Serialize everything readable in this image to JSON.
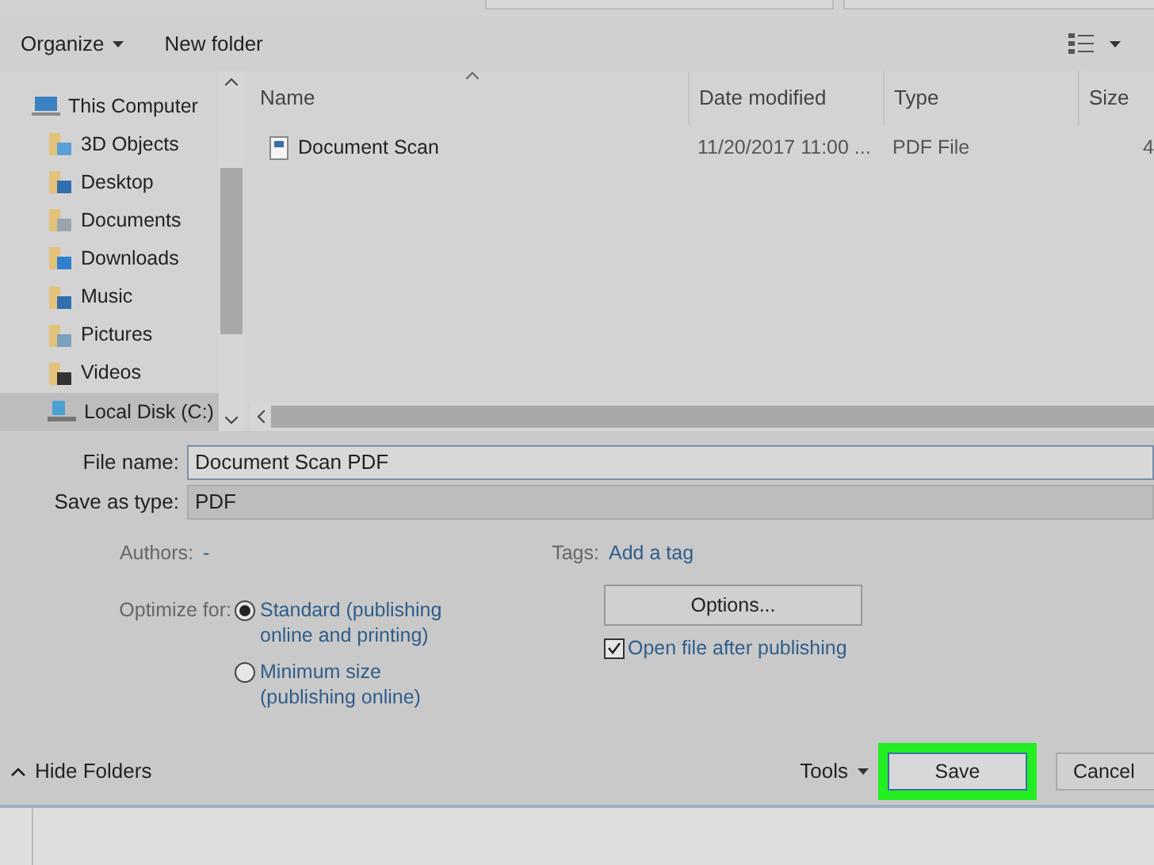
{
  "toolbar": {
    "organize": "Organize",
    "new_folder": "New folder"
  },
  "sidebar": {
    "items": [
      {
        "label": "This Computer",
        "kind": "computer",
        "selected": false,
        "children": [
          {
            "label": "3D Objects",
            "kind": "objects",
            "selected": false
          },
          {
            "label": "Desktop",
            "kind": "desktop",
            "selected": false
          },
          {
            "label": "Documents",
            "kind": "documents",
            "selected": false
          },
          {
            "label": "Downloads",
            "kind": "downloads",
            "selected": false
          },
          {
            "label": "Music",
            "kind": "music",
            "selected": false
          },
          {
            "label": "Pictures",
            "kind": "pictures",
            "selected": false
          },
          {
            "label": "Videos",
            "kind": "videos",
            "selected": false
          },
          {
            "label": "Local Disk (C:)",
            "kind": "disk",
            "selected": true
          }
        ]
      }
    ]
  },
  "table": {
    "columns": [
      "Name",
      "Date modified",
      "Type",
      "Size"
    ],
    "rows": [
      {
        "name": "Document Scan",
        "date": "11/20/2017 11:00 ...",
        "type": "PDF File",
        "size": "4"
      }
    ]
  },
  "form": {
    "file_name_label": "File name:",
    "file_name": "Document Scan PDF",
    "type_label": "Save as type:",
    "type": "PDF",
    "authors_label": "Authors:",
    "authors": "-",
    "tags_label": "Tags:",
    "tags": "Add a tag",
    "optimize_label": "Optimize for:",
    "options": [
      {
        "label": "Standard (publishing online and printing)",
        "selected": true
      },
      {
        "label": "Minimum size (publishing online)",
        "selected": false
      }
    ],
    "options_button": "Options...",
    "open_after": {
      "label": "Open file after publishing",
      "checked": true
    }
  },
  "footer": {
    "hide_folders": "Hide Folders",
    "tools": "Tools",
    "save": "Save",
    "cancel": "Cancel",
    "save_highlighted": true
  }
}
